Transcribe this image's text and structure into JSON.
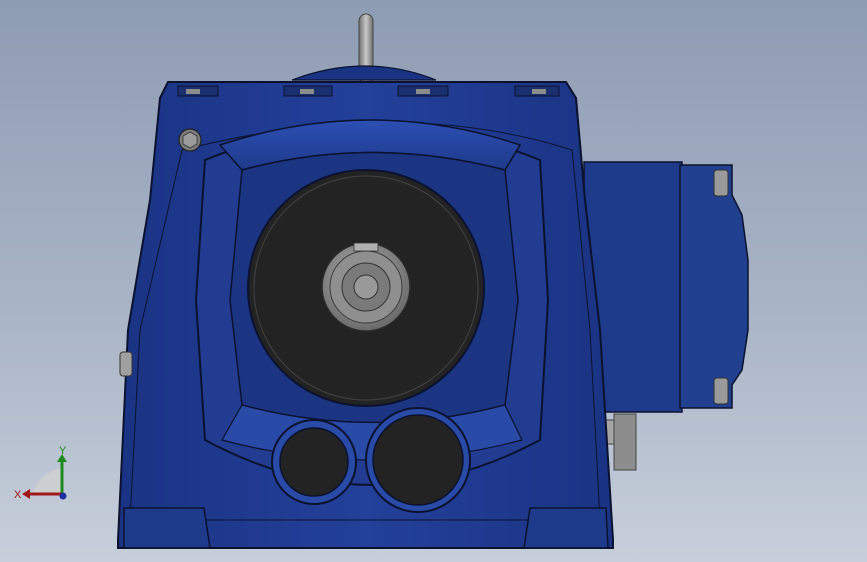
{
  "viewport": {
    "background_top": "#8e9cb3",
    "background_bottom": "#c7cfdb"
  },
  "model": {
    "body_color": "#1e3a8a",
    "edge_color": "#0b1230",
    "opening_color": "#222222",
    "shaft_color": "#8c8c8c",
    "bolt_color": "#9a9a9a"
  },
  "triad": {
    "x_label": "X",
    "y_label": "Y",
    "x_color": "#a01818",
    "y_color": "#1e8a1e",
    "z_color": "#1e2fa0"
  }
}
